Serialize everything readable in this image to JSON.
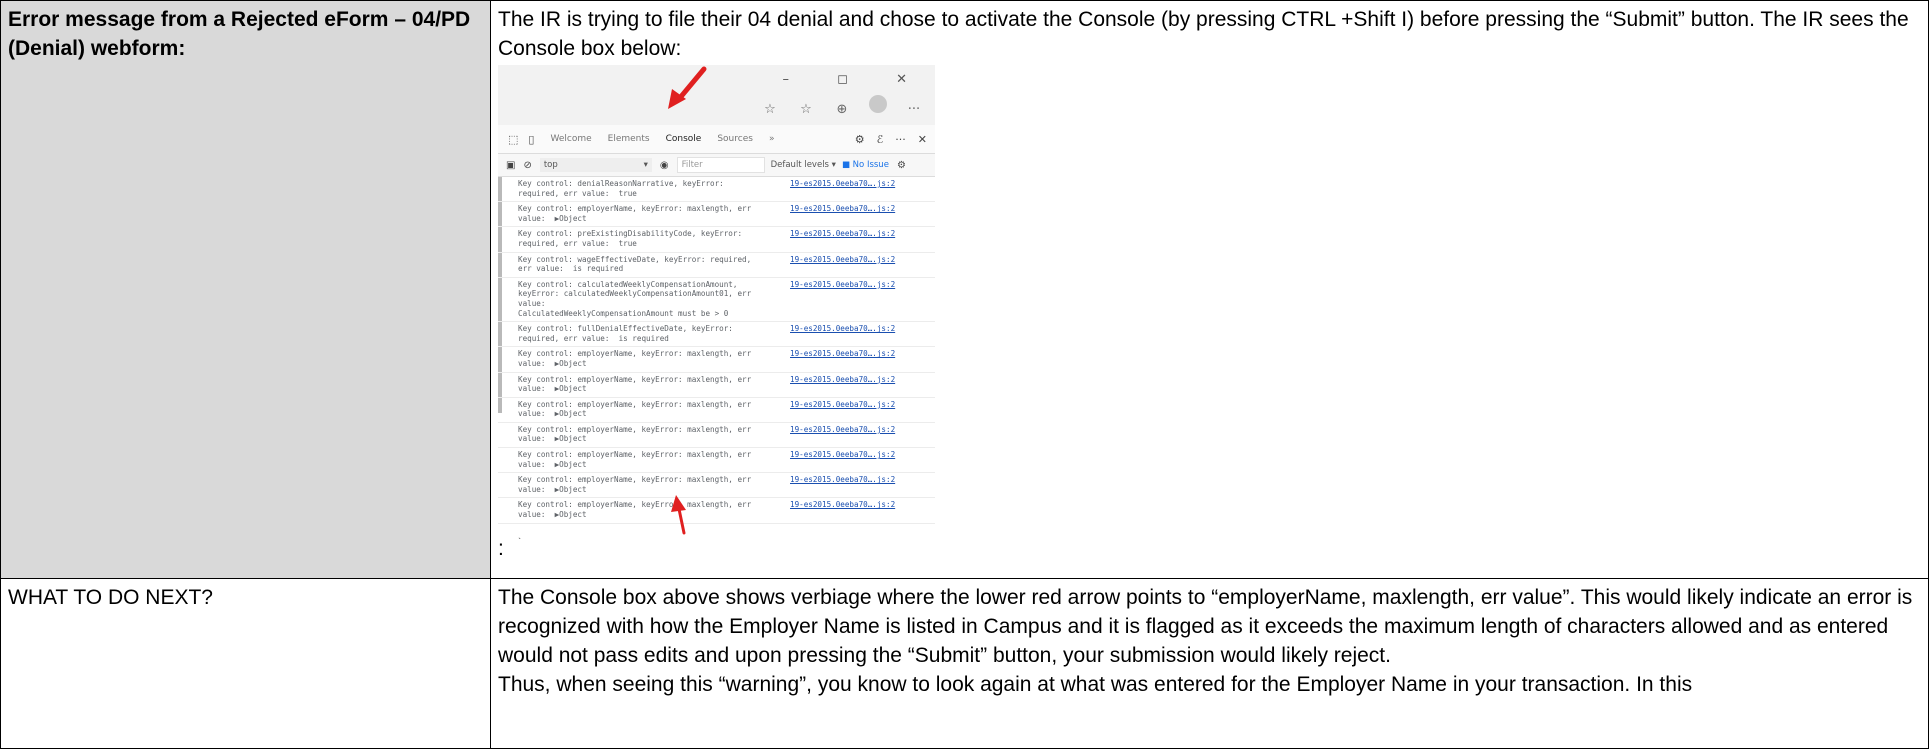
{
  "rows": [
    {
      "label": "Error message from a Rejected eForm – 04/PD (Denial) webform:",
      "text": "The IR is trying to file their 04 denial and chose to activate the Console (by pressing CTRL +Shift I) before pressing the “Submit” button. The IR sees the Console box below:",
      "trailing": ":"
    },
    {
      "label": "WHAT TO DO NEXT?",
      "paragraphs": [
        "The Console box above shows verbiage where the lower red arrow points to “employerName, maxlength, err value”. This would likely indicate an error is recognized with how the Employer Name is listed in Campus and it is flagged as it exceeds the maximum length of characters allowed and as entered would not pass edits and upon pressing the “Submit” button, your submission would likely reject.",
        "Thus, when seeing this “warning”, you know to look again at what was entered for the Employer Name in your transaction. In this"
      ]
    }
  ],
  "devtools": {
    "window_buttons": "–  ◻  ✕",
    "toolbar_icons": [
      "☆",
      "☆",
      "⊕"
    ],
    "more": "···",
    "tabs": [
      "Welcome",
      "Elements",
      "Console",
      "Sources",
      "»"
    ],
    "active_tab": "Console",
    "settings_icons": [
      "⚙",
      "ℰ",
      "···",
      "✕"
    ],
    "context": "top",
    "filter_placeholder": "Filter",
    "levels": "Default levels ▾",
    "issues": "■ No Issue",
    "logs": [
      {
        "msg": "Key control: denialReasonNarrative, keyError:\nrequired, err value:  true",
        "src": "19-es2015.0eeba70….js:2"
      },
      {
        "msg": "Key control: employerName, keyError: maxlength, err\nvalue:  ▶Object",
        "src": "19-es2015.0eeba70….js:2"
      },
      {
        "msg": "Key control: preExistingDisabilityCode, keyError:\nrequired, err value:  true",
        "src": "19-es2015.0eeba70….js:2"
      },
      {
        "msg": "Key control: wageEffectiveDate, keyError: required,\nerr value:  is required",
        "src": "19-es2015.0eeba70….js:2"
      },
      {
        "msg": "Key control: calculatedWeeklyCompensationAmount,\nkeyError: calculatedWeeklyCompensationAmount01, err value:\nCalculatedWeeklyCompensationAmount must be > 0",
        "src": "19-es2015.0eeba70….js:2"
      },
      {
        "msg": "Key control: fullDenialEffectiveDate, keyError:\nrequired, err value:  is required",
        "src": "19-es2015.0eeba70….js:2"
      },
      {
        "msg": "Key control: employerName, keyError: maxlength, err\nvalue:  ▶Object",
        "src": "19-es2015.0eeba70….js:2"
      },
      {
        "msg": "Key control: employerName, keyError: maxlength, err\nvalue:  ▶Object",
        "src": "19-es2015.0eeba70….js:2"
      },
      {
        "msg": "Key control: employerName, keyError: maxlength, err\nvalue:  ▶Object",
        "src": "19-es2015.0eeba70….js:2"
      },
      {
        "msg": "Key control: employerName, keyError: maxlength, err\nvalue:  ▶Object",
        "src": "19-es2015.0eeba70….js:2"
      },
      {
        "msg": "Key control: employerName, keyError: maxlength, err\nvalue:  ▶Object",
        "src": "19-es2015.0eeba70….js:2"
      },
      {
        "msg": "Key control: employerName, keyError: maxlength, err\nvalue:  ▶Object",
        "src": "19-es2015.0eeba70….js:2"
      },
      {
        "msg": "Key control: employerName, keyError: maxlength, err\nvalue:  ▶Object",
        "src": "19-es2015.0eeba70….js:2"
      }
    ],
    "prompt": "›",
    "arrow_color": "#e02020"
  }
}
